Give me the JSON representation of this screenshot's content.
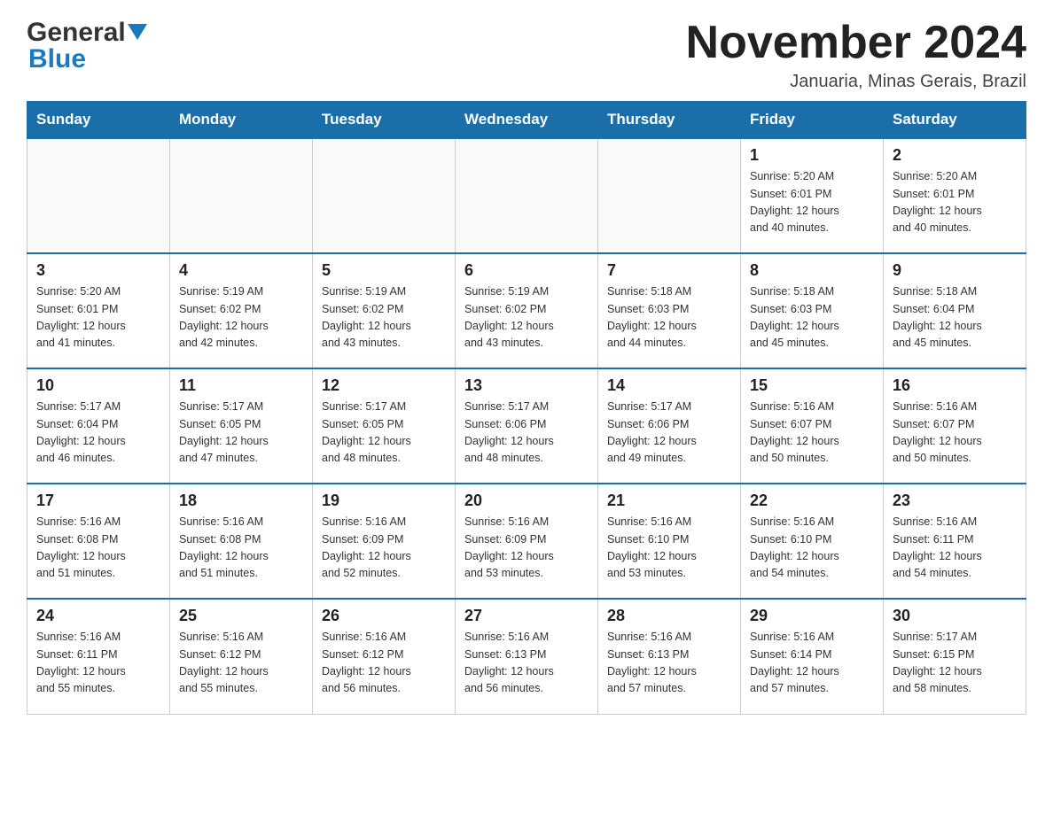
{
  "header": {
    "logo_general": "General",
    "logo_blue": "Blue",
    "title": "November 2024",
    "subtitle": "Januaria, Minas Gerais, Brazil"
  },
  "days_of_week": [
    "Sunday",
    "Monday",
    "Tuesday",
    "Wednesday",
    "Thursday",
    "Friday",
    "Saturday"
  ],
  "weeks": [
    [
      {
        "day": "",
        "info": ""
      },
      {
        "day": "",
        "info": ""
      },
      {
        "day": "",
        "info": ""
      },
      {
        "day": "",
        "info": ""
      },
      {
        "day": "",
        "info": ""
      },
      {
        "day": "1",
        "info": "Sunrise: 5:20 AM\nSunset: 6:01 PM\nDaylight: 12 hours\nand 40 minutes."
      },
      {
        "day": "2",
        "info": "Sunrise: 5:20 AM\nSunset: 6:01 PM\nDaylight: 12 hours\nand 40 minutes."
      }
    ],
    [
      {
        "day": "3",
        "info": "Sunrise: 5:20 AM\nSunset: 6:01 PM\nDaylight: 12 hours\nand 41 minutes."
      },
      {
        "day": "4",
        "info": "Sunrise: 5:19 AM\nSunset: 6:02 PM\nDaylight: 12 hours\nand 42 minutes."
      },
      {
        "day": "5",
        "info": "Sunrise: 5:19 AM\nSunset: 6:02 PM\nDaylight: 12 hours\nand 43 minutes."
      },
      {
        "day": "6",
        "info": "Sunrise: 5:19 AM\nSunset: 6:02 PM\nDaylight: 12 hours\nand 43 minutes."
      },
      {
        "day": "7",
        "info": "Sunrise: 5:18 AM\nSunset: 6:03 PM\nDaylight: 12 hours\nand 44 minutes."
      },
      {
        "day": "8",
        "info": "Sunrise: 5:18 AM\nSunset: 6:03 PM\nDaylight: 12 hours\nand 45 minutes."
      },
      {
        "day": "9",
        "info": "Sunrise: 5:18 AM\nSunset: 6:04 PM\nDaylight: 12 hours\nand 45 minutes."
      }
    ],
    [
      {
        "day": "10",
        "info": "Sunrise: 5:17 AM\nSunset: 6:04 PM\nDaylight: 12 hours\nand 46 minutes."
      },
      {
        "day": "11",
        "info": "Sunrise: 5:17 AM\nSunset: 6:05 PM\nDaylight: 12 hours\nand 47 minutes."
      },
      {
        "day": "12",
        "info": "Sunrise: 5:17 AM\nSunset: 6:05 PM\nDaylight: 12 hours\nand 48 minutes."
      },
      {
        "day": "13",
        "info": "Sunrise: 5:17 AM\nSunset: 6:06 PM\nDaylight: 12 hours\nand 48 minutes."
      },
      {
        "day": "14",
        "info": "Sunrise: 5:17 AM\nSunset: 6:06 PM\nDaylight: 12 hours\nand 49 minutes."
      },
      {
        "day": "15",
        "info": "Sunrise: 5:16 AM\nSunset: 6:07 PM\nDaylight: 12 hours\nand 50 minutes."
      },
      {
        "day": "16",
        "info": "Sunrise: 5:16 AM\nSunset: 6:07 PM\nDaylight: 12 hours\nand 50 minutes."
      }
    ],
    [
      {
        "day": "17",
        "info": "Sunrise: 5:16 AM\nSunset: 6:08 PM\nDaylight: 12 hours\nand 51 minutes."
      },
      {
        "day": "18",
        "info": "Sunrise: 5:16 AM\nSunset: 6:08 PM\nDaylight: 12 hours\nand 51 minutes."
      },
      {
        "day": "19",
        "info": "Sunrise: 5:16 AM\nSunset: 6:09 PM\nDaylight: 12 hours\nand 52 minutes."
      },
      {
        "day": "20",
        "info": "Sunrise: 5:16 AM\nSunset: 6:09 PM\nDaylight: 12 hours\nand 53 minutes."
      },
      {
        "day": "21",
        "info": "Sunrise: 5:16 AM\nSunset: 6:10 PM\nDaylight: 12 hours\nand 53 minutes."
      },
      {
        "day": "22",
        "info": "Sunrise: 5:16 AM\nSunset: 6:10 PM\nDaylight: 12 hours\nand 54 minutes."
      },
      {
        "day": "23",
        "info": "Sunrise: 5:16 AM\nSunset: 6:11 PM\nDaylight: 12 hours\nand 54 minutes."
      }
    ],
    [
      {
        "day": "24",
        "info": "Sunrise: 5:16 AM\nSunset: 6:11 PM\nDaylight: 12 hours\nand 55 minutes."
      },
      {
        "day": "25",
        "info": "Sunrise: 5:16 AM\nSunset: 6:12 PM\nDaylight: 12 hours\nand 55 minutes."
      },
      {
        "day": "26",
        "info": "Sunrise: 5:16 AM\nSunset: 6:12 PM\nDaylight: 12 hours\nand 56 minutes."
      },
      {
        "day": "27",
        "info": "Sunrise: 5:16 AM\nSunset: 6:13 PM\nDaylight: 12 hours\nand 56 minutes."
      },
      {
        "day": "28",
        "info": "Sunrise: 5:16 AM\nSunset: 6:13 PM\nDaylight: 12 hours\nand 57 minutes."
      },
      {
        "day": "29",
        "info": "Sunrise: 5:16 AM\nSunset: 6:14 PM\nDaylight: 12 hours\nand 57 minutes."
      },
      {
        "day": "30",
        "info": "Sunrise: 5:17 AM\nSunset: 6:15 PM\nDaylight: 12 hours\nand 58 minutes."
      }
    ]
  ]
}
